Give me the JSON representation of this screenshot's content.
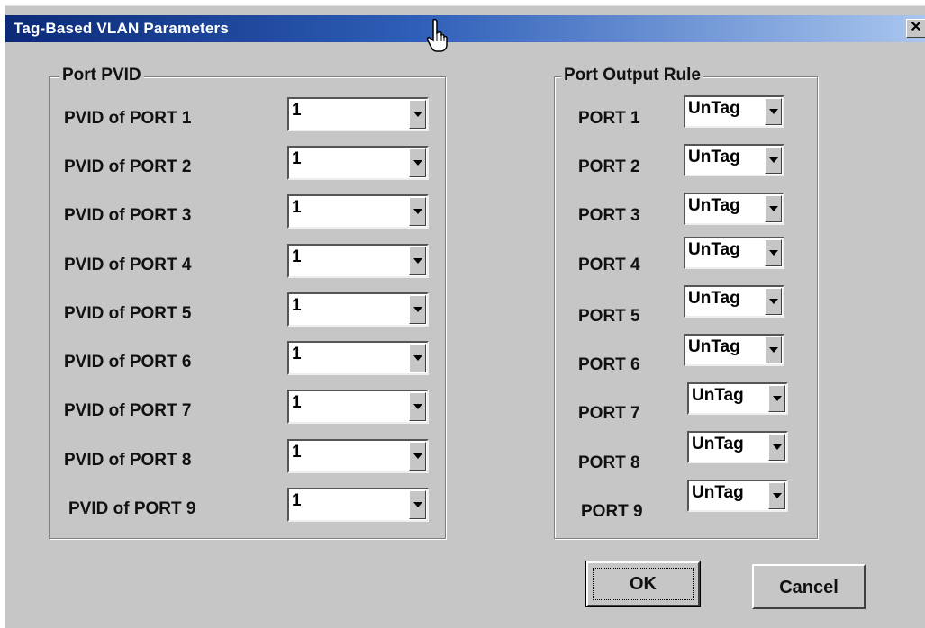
{
  "window": {
    "title": "Tag-Based VLAN Parameters",
    "close_symbol": "✕"
  },
  "pvid_group": {
    "title": "Port PVID",
    "rows": [
      {
        "label": "PVID of PORT 1",
        "value": "1"
      },
      {
        "label": "PVID of PORT 2",
        "value": "1"
      },
      {
        "label": "PVID of PORT 3",
        "value": "1"
      },
      {
        "label": "PVID of PORT 4",
        "value": "1"
      },
      {
        "label": "PVID of PORT 5",
        "value": "1"
      },
      {
        "label": "PVID of PORT 6",
        "value": "1"
      },
      {
        "label": "PVID of PORT 7",
        "value": "1"
      },
      {
        "label": "PVID of PORT 8",
        "value": "1"
      },
      {
        "label": "PVID of PORT 9",
        "value": "1"
      }
    ]
  },
  "output_group": {
    "title": "Port Output Rule",
    "rows": [
      {
        "label": "PORT 1",
        "value": "UnTag"
      },
      {
        "label": "PORT 2",
        "value": "UnTag"
      },
      {
        "label": "PORT 3",
        "value": "UnTag"
      },
      {
        "label": "PORT 4",
        "value": "UnTag"
      },
      {
        "label": "PORT 5",
        "value": "UnTag"
      },
      {
        "label": "PORT 6",
        "value": "UnTag"
      },
      {
        "label": "PORT 7",
        "value": "UnTag"
      },
      {
        "label": "PORT 8",
        "value": "UnTag"
      },
      {
        "label": "PORT 9",
        "value": "UnTag"
      }
    ]
  },
  "buttons": {
    "ok": "OK",
    "cancel": "Cancel"
  },
  "icons": {
    "cursor": "hand-pointer-icon",
    "close": "close-icon",
    "dropdown": "chevron-down-icon"
  },
  "colors": {
    "title_start": "#0b2a78",
    "title_end": "#a9c6ee",
    "face": "#c6c6c6"
  }
}
